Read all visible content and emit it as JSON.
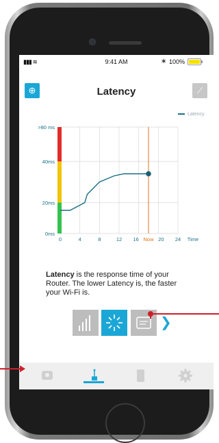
{
  "status_bar": {
    "time": "9:41 AM",
    "battery": "100%"
  },
  "header": {
    "title": "Latency"
  },
  "chart_data": {
    "type": "line",
    "legend": "Latency",
    "xlabel": "Time",
    "x_ticks": [
      "0",
      "4",
      "8",
      "12",
      "16",
      "Now",
      "20",
      "24"
    ],
    "y_ticks": [
      ">80 ms",
      "40ms",
      "20ms",
      "0ms"
    ],
    "y_tick_values": [
      80,
      40,
      20,
      0
    ],
    "now_x": 18,
    "series": [
      {
        "name": "Latency",
        "x": [
          0,
          2,
          5,
          5.5,
          8,
          11,
          13,
          18
        ],
        "y": [
          15,
          15,
          20,
          24,
          30,
          33,
          34,
          34
        ]
      }
    ],
    "xlim": [
      0,
      24
    ],
    "zones": [
      {
        "color": "#e32b2b",
        "from": 40,
        "to": 80
      },
      {
        "color": "#f2c500",
        "from": 20,
        "to": 40
      },
      {
        "color": "#33c24d",
        "from": 0,
        "to": 20
      }
    ],
    "colors": {
      "line": "#1a6f86",
      "now": "#e0731f",
      "grid": "#d9d9d9"
    }
  },
  "description": {
    "bold": "Latency",
    "text": " is the response time of your Router. The lower Latency is, the faster your Wi-Fi is."
  },
  "tiles": [
    "signal-bars-icon",
    "latency-burst-icon",
    "router-card-icon"
  ],
  "bottom_nav": [
    "camera-icon",
    "router-icon",
    "phone-icon",
    "settings-gear-icon"
  ],
  "accent_color": "#1ba7d6",
  "annotation_color": "#cc1f2b"
}
